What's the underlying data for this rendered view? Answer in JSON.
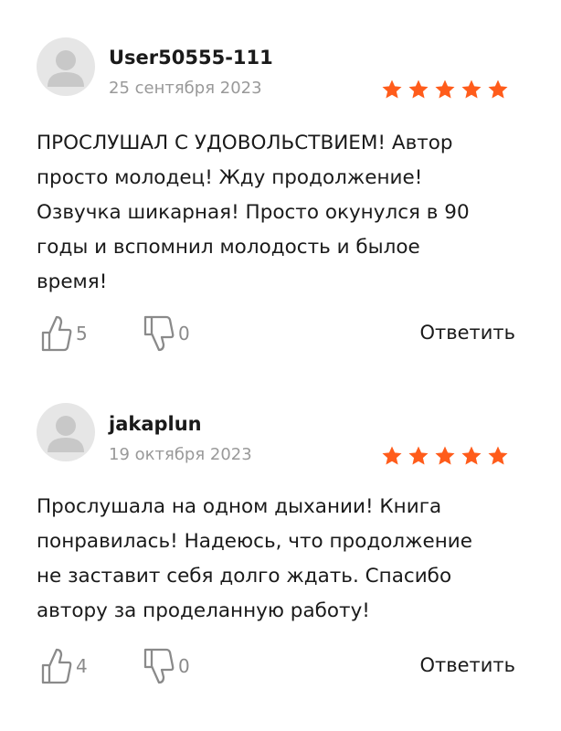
{
  "colors": {
    "star": "#ff5c1b",
    "date": "#999999",
    "icon": "#8a8a8a",
    "avatar_bg": "#e6e6e6",
    "avatar_fg": "#c8c8c8"
  },
  "reviews": [
    {
      "avatar_icon": "user-avatar-icon",
      "username": "User50555-111",
      "date": "25 сентября 2023",
      "rating": 5,
      "text_lines": [
        "ПРОСЛУШАЛ С УДОВОЛЬСТВИЕМ! Автор",
        "просто молодец! Жду продолжение!",
        "Озвучка шикарная! Просто окунулся в 90",
        "годы и вспомнил молодость и былое",
        "время!"
      ],
      "likes": "5",
      "dislikes": "0",
      "reply_label": "Ответить"
    },
    {
      "avatar_icon": "user-avatar-icon",
      "username": "jakaplun",
      "date": "19 октября 2023",
      "rating": 5,
      "text_lines": [
        "Прослушала на одном дыхании! Книга",
        "понравилась! Надеюсь, что продолжение",
        "не заставит себя долго ждать. Спасибо",
        "автору за проделанную работу!"
      ],
      "likes": "4",
      "dislikes": "0",
      "reply_label": "Ответить"
    }
  ]
}
